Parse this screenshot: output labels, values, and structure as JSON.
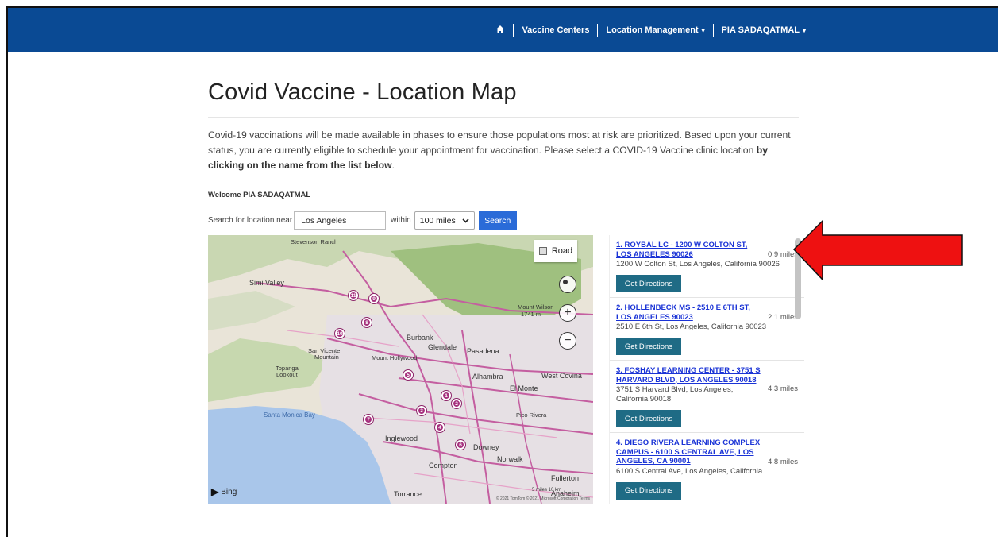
{
  "nav": {
    "home_icon": "home-icon",
    "items": [
      {
        "label": "Vaccine Centers",
        "has_caret": false
      },
      {
        "label": "Location Management",
        "has_caret": true
      },
      {
        "label": "PIA SADAQATMAL",
        "has_caret": true
      }
    ],
    "caret": "▾"
  },
  "page": {
    "title": "Covid Vaccine - Location Map",
    "intro_text": "Covid-19 vaccinations will be made available in phases to ensure those populations most at risk are prioritized. Based upon your current status, you are currently eligible to schedule your appointment for vaccination. Please select a COVID-19 Vaccine clinic location ",
    "intro_bold": "by clicking on the name from the list below",
    "intro_end": ".",
    "welcome": "Welcome PIA SADAQATMAL"
  },
  "search": {
    "label": "Search for location near",
    "value": "Los Angeles",
    "within_label": "within",
    "radius": "100 miles",
    "button": "Search"
  },
  "map": {
    "road_button": "Road",
    "bing": "Bing",
    "copyright": "© 2021 TomTom © 2021 Microsoft Corporation Terms",
    "scale": "5 miles     10 km",
    "labels": {
      "stevenson_ranch": "Stevenson Ranch",
      "simi_valley": "Simi Valley",
      "mount_wilson": "Mount Wilson",
      "mount_wilson_elev": "1741 m",
      "burbank": "Burbank",
      "glendale": "Glendale",
      "pasadena": "Pasadena",
      "san_vicente": "San Vicente",
      "mountain": "Mountain",
      "mount_hollywood": "Mount Hollywood",
      "topanga": "Topanga",
      "lookout": "Lookout",
      "alhambra": "Alhambra",
      "west_covina": "West Covina",
      "el_monte": "El Monte",
      "santa_monica_bay": "Santa Monica Bay",
      "pico_rivera": "Pico Rivera",
      "inglewood": "Inglewood",
      "downey": "Downey",
      "norwalk": "Norwalk",
      "compton": "Compton",
      "fullerton": "Fullerton",
      "torrance": "Torrance",
      "anaheim": "Anaheim"
    },
    "pins": [
      "1",
      "2",
      "3",
      "4",
      "5",
      "6",
      "7",
      "8",
      "9",
      "10",
      "11"
    ]
  },
  "locations": [
    {
      "name": "1. ROYBAL LC - 1200 W COLTON ST, LOS ANGELES 90026",
      "distance": "0.9 miles",
      "address": "1200 W Colton St, Los Angeles, California 90026",
      "button": "Get Directions"
    },
    {
      "name": "2. HOLLENBECK MS - 2510 E 6TH ST, LOS ANGELES 90023",
      "distance": "2.1 miles",
      "address": "2510 E 6th St, Los Angeles, California 90023",
      "button": "Get Directions"
    },
    {
      "name": "3. FOSHAY LEARNING CENTER - 3751 S HARVARD BLVD, LOS ANGELES 90018",
      "distance": "4.3 miles",
      "address": "3751 S Harvard Blvd, Los Angeles, California 90018",
      "button": "Get Directions"
    },
    {
      "name": "4. DIEGO RIVERA LEARNING COMPLEX CAMPUS - 6100 S CENTRAL AVE, LOS ANGELES, CA 90001",
      "distance": "4.8 miles",
      "address": "6100 S Central Ave, Los Angeles, California",
      "button": "Get Directions"
    }
  ],
  "colors": {
    "navbar": "#0a4a94",
    "search_button": "#2a6bd8",
    "directions_button": "#1f6b85",
    "link": "#1a33d6",
    "pin": "#a6317e",
    "arrow": "#ee1111"
  }
}
